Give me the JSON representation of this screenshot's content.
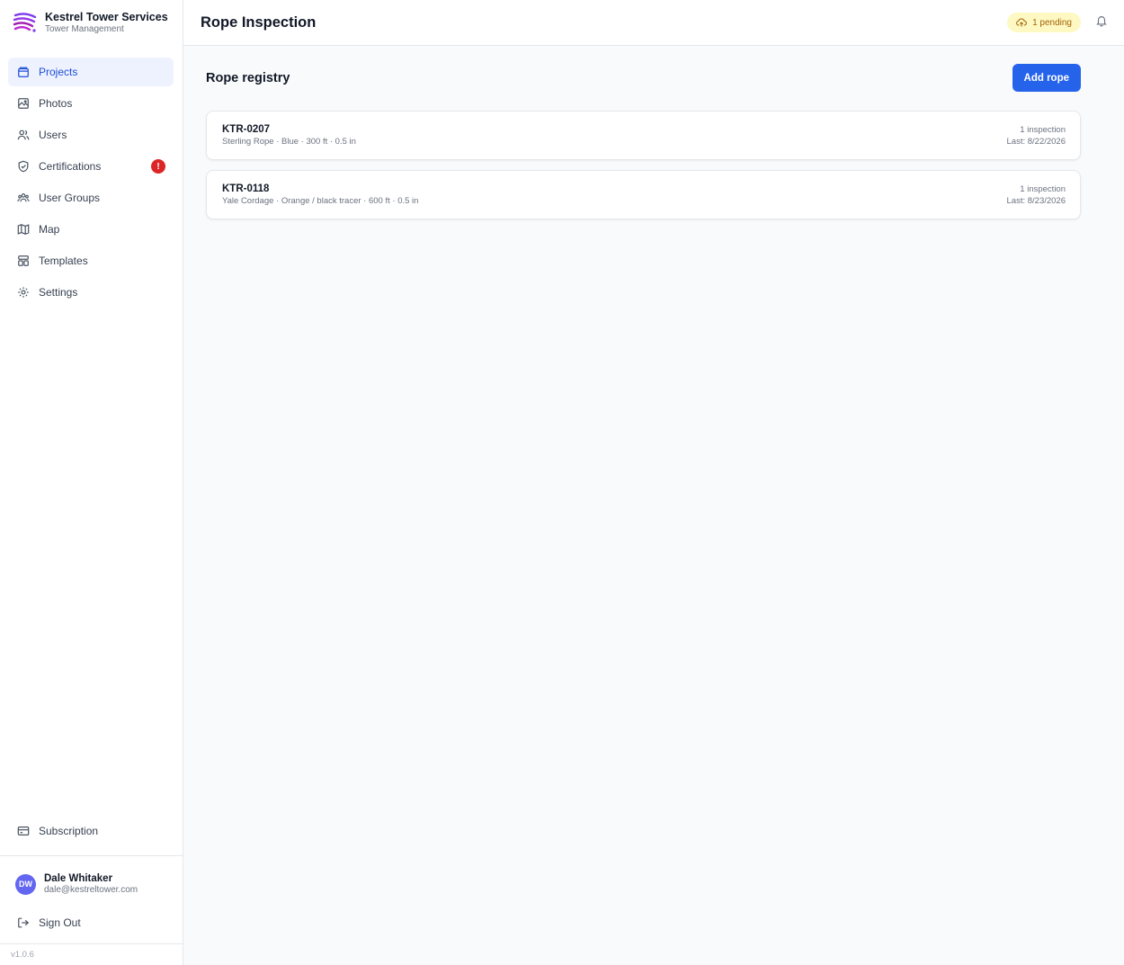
{
  "brand": {
    "name": "Kestrel Tower Services",
    "subtitle": "Tower Management"
  },
  "nav": {
    "items": [
      {
        "label": "Projects",
        "icon": "folder-icon"
      },
      {
        "label": "Photos",
        "icon": "image-icon"
      },
      {
        "label": "Users",
        "icon": "users-icon"
      },
      {
        "label": "Certifications",
        "icon": "shield-check-icon",
        "alert": "!"
      },
      {
        "label": "User Groups",
        "icon": "user-group-icon"
      },
      {
        "label": "Map",
        "icon": "map-icon"
      },
      {
        "label": "Templates",
        "icon": "template-icon"
      },
      {
        "label": "Settings",
        "icon": "gear-icon"
      }
    ],
    "subscription": "Subscription",
    "sign_out": "Sign Out"
  },
  "user": {
    "initials": "DW",
    "name": "Dale Whitaker",
    "email": "dale@kestreltower.com"
  },
  "version": "v1.0.6",
  "header": {
    "title": "Rope Inspection",
    "pending": "1 pending"
  },
  "main": {
    "section_title": "Rope registry",
    "add_button": "Add rope",
    "ropes": [
      {
        "id": "KTR-0207",
        "desc": "Sterling Rope · Blue · 300 ft · 0.5 in",
        "count": "1 inspection",
        "last": "Last: 8/22/2026"
      },
      {
        "id": "KTR-0118",
        "desc": "Yale Cordage · Orange / black tracer · 600 ft · 0.5 in",
        "count": "1 inspection",
        "last": "Last: 8/23/2026"
      }
    ]
  },
  "colors": {
    "accent": "#2563eb",
    "active_bg": "#eef2ff",
    "alert": "#dc2626",
    "pending_bg": "#fef9c3",
    "avatar": "#6366f1"
  }
}
